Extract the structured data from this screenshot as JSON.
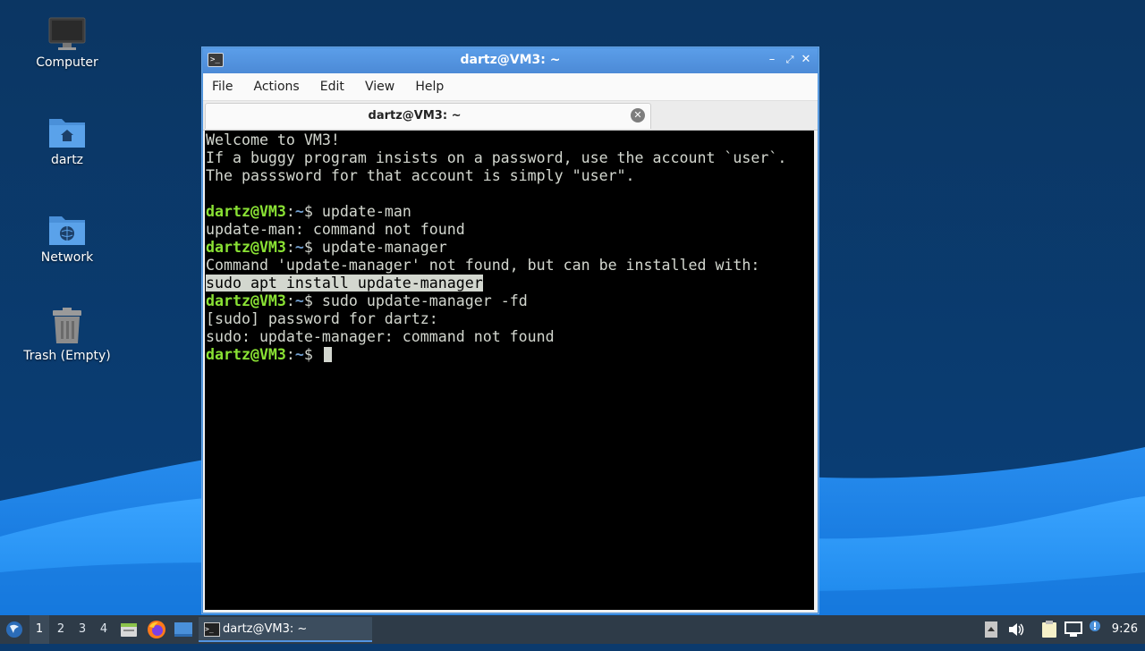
{
  "desktop": {
    "icons": [
      {
        "label": "Computer",
        "icon": "monitor-icon"
      },
      {
        "label": "dartz",
        "icon": "home-folder-icon"
      },
      {
        "label": "Network",
        "icon": "network-folder-icon"
      },
      {
        "label": "Trash (Empty)",
        "icon": "trash-icon"
      }
    ]
  },
  "window": {
    "title": "dartz@VM3: ~",
    "menu": [
      "File",
      "Actions",
      "Edit",
      "View",
      "Help"
    ],
    "tab_title": "dartz@VM3: ~"
  },
  "terminal": {
    "welcome": [
      "Welcome to VM3!",
      "If a buggy program insists on a password, use the account `user`.",
      "The passsword for that account is simply \"user\"."
    ],
    "prompt_user": "dartz@VM3",
    "prompt_sep": ":",
    "prompt_dir": "~",
    "prompt_sign": "$ ",
    "cmd1": "update-man",
    "out1": "update-man: command not found",
    "cmd2": "update-manager",
    "out2": "Command 'update-manager' not found, but can be installed with:",
    "out2_highlight": "sudo apt install update-manager",
    "cmd3": "sudo update-manager -fd",
    "out3a": "[sudo] password for dartz:",
    "out3b": "sudo: update-manager: command not found"
  },
  "taskbar": {
    "workspaces": [
      "1",
      "2",
      "3",
      "4"
    ],
    "active_workspace": "1",
    "task_label": "dartz@VM3: ~",
    "clock": "9:26",
    "icons": [
      "start-menu-icon",
      "file-manager-icon",
      "firefox-icon",
      "show-desktop-icon",
      "tray-up-icon",
      "volume-icon",
      "clipboard-icon",
      "network-icon",
      "update-notifier-icon"
    ]
  },
  "colors": {
    "prompt_user": "#8ae234",
    "prompt_dir": "#729fcf",
    "titlebar": "#5294e2",
    "taskbar": "#2e3b48"
  }
}
